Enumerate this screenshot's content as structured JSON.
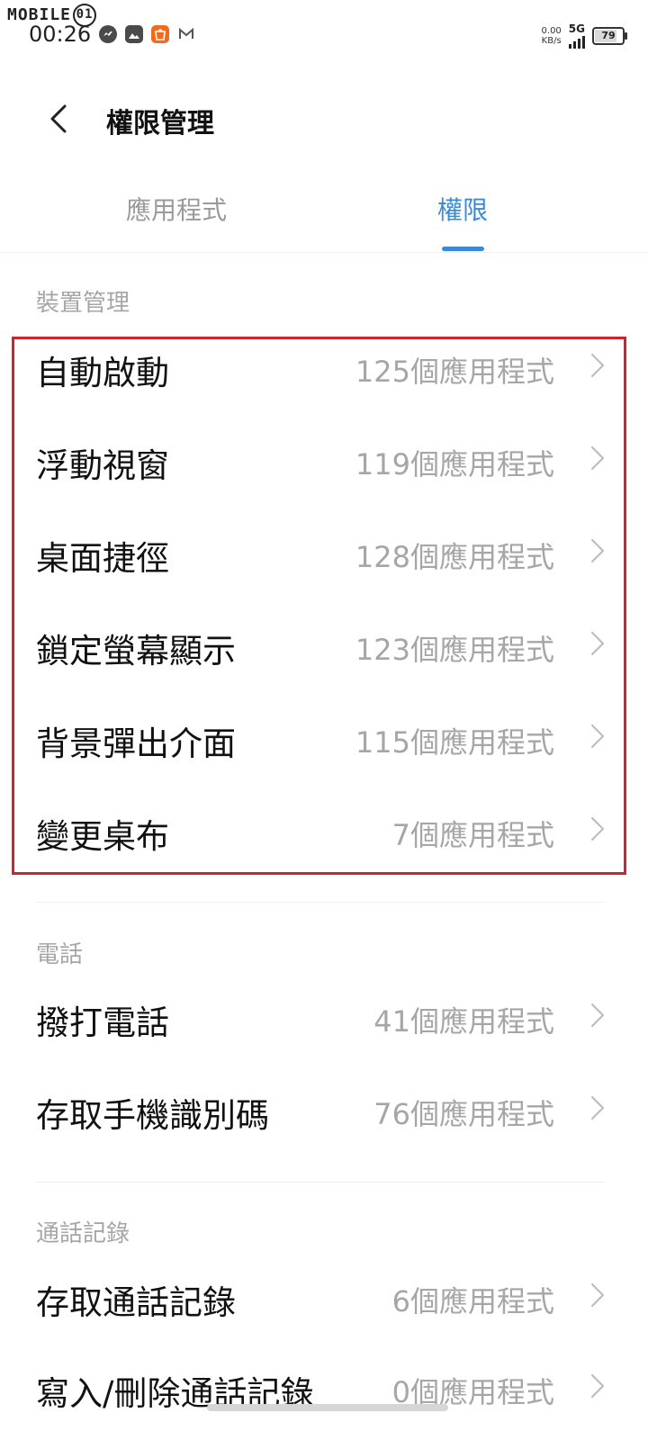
{
  "status": {
    "watermark": "MOBILE",
    "watermark_badge": "01",
    "time": "00:26",
    "net_speed_value": "0.00",
    "net_speed_unit": "KB/s",
    "network": "5G",
    "battery": "79",
    "battery_level_percent": 79,
    "notification_icons": [
      "messenger-icon",
      "photos-icon",
      "shopee-icon",
      "gmail-icon"
    ]
  },
  "header": {
    "title": "權限管理"
  },
  "tabs": [
    {
      "label": "應用程式",
      "active": false
    },
    {
      "label": "權限",
      "active": true
    }
  ],
  "colors": {
    "accent": "#3a8ad8",
    "highlight_box": "#d1222d",
    "secondary_text": "#a6a6a6"
  },
  "sections": [
    {
      "header": "裝置管理",
      "items": [
        {
          "label": "自動啟動",
          "count": "125個應用程式"
        },
        {
          "label": "浮動視窗",
          "count": "119個應用程式"
        },
        {
          "label": "桌面捷徑",
          "count": "128個應用程式"
        },
        {
          "label": "鎖定螢幕顯示",
          "count": "123個應用程式"
        },
        {
          "label": "背景彈出介面",
          "count": "115個應用程式"
        },
        {
          "label": "變更桌布",
          "count": "7個應用程式"
        }
      ]
    },
    {
      "header": "電話",
      "items": [
        {
          "label": "撥打電話",
          "count": "41個應用程式"
        },
        {
          "label": "存取手機識別碼",
          "count": "76個應用程式"
        }
      ]
    },
    {
      "header": "通話記錄",
      "items": [
        {
          "label": "存取通話記錄",
          "count": "6個應用程式"
        },
        {
          "label": "寫入/刪除通話記錄",
          "count": "0個應用程式"
        }
      ]
    }
  ]
}
